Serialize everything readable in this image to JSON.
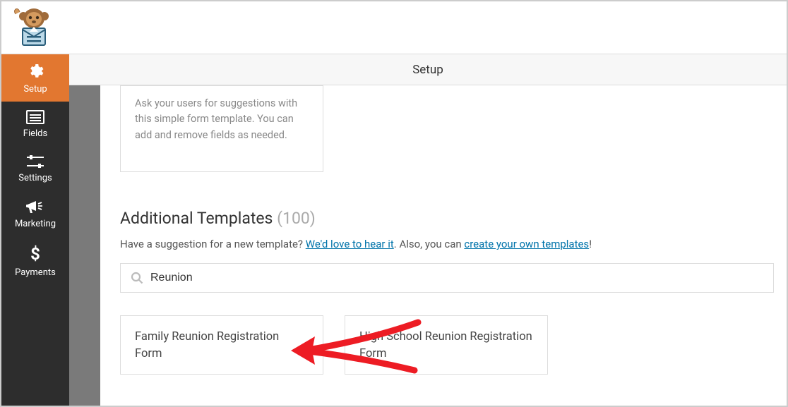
{
  "header": {
    "title": "Setup"
  },
  "sidebar": {
    "items": [
      {
        "label": "Setup"
      },
      {
        "label": "Fields"
      },
      {
        "label": "Settings"
      },
      {
        "label": "Marketing"
      },
      {
        "label": "Payments"
      }
    ]
  },
  "card": {
    "text": "Ask your users for suggestions with this simple form template. You can add and remove fields as needed."
  },
  "section": {
    "title": "Additional Templates",
    "count": "(100)"
  },
  "hint": {
    "pre": "Have a suggestion for a new template? ",
    "link1": "We'd love to hear it",
    "mid": ". Also, you can ",
    "link2": "create your own templates",
    "post": "!"
  },
  "search": {
    "value": "Reunion"
  },
  "results": [
    {
      "title": "Family Reunion Registration Form"
    },
    {
      "title": "High School Reunion Registration Form"
    }
  ]
}
